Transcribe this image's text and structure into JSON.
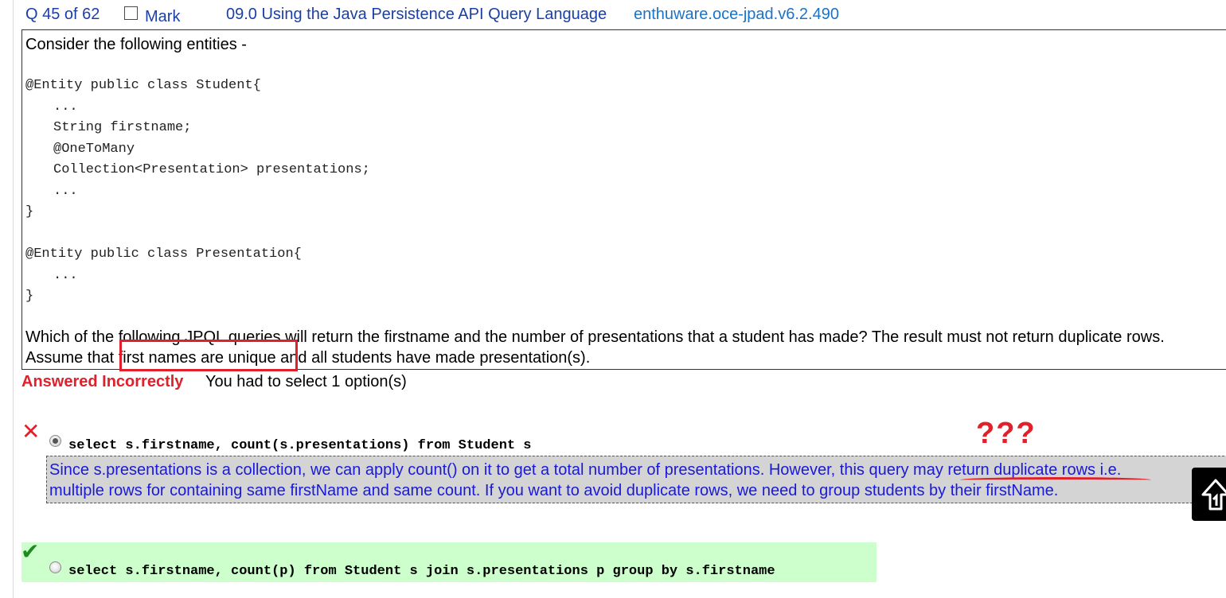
{
  "header": {
    "counter": "Q 45 of 62",
    "mark_label": "Mark",
    "topic": "09.0 Using the Java Persistence API Query Language",
    "question_id": "enthuware.oce-jpad.v6.2.490"
  },
  "question": {
    "intro": "Consider the following entities -",
    "code": [
      "@Entity public class Student{",
      "...",
      "String firstname;",
      "@OneToMany",
      "Collection<Presentation> presentations;",
      "...",
      "}",
      "@Entity public class Presentation{",
      "...",
      "}"
    ],
    "prompt_line1": "Which of the following JPQL queries will return the firstname and the number of presentations that a student has made? The result must not return duplicate rows.",
    "prompt_line2": "Assume that first names are unique and all students have made presentation(s)."
  },
  "result": {
    "status": "Answered Incorrectly",
    "note": "You had to select 1 option(s)"
  },
  "options": [
    {
      "text": "select s.firstname, count(s.presentations) from Student s",
      "selected": true,
      "correct": false,
      "explanation_line1": "Since s.presentations is a collection, we can apply count() on it to get a total number of presentations. However, this query may return duplicate rows i.e.",
      "explanation_line2": "multiple rows for containing same firstName and same count. If you want to avoid duplicate rows, we need to group students by their firstName."
    },
    {
      "text": "select s.firstname, count(p) from Student s join s.presentations p group by s.firstname",
      "selected": false,
      "correct": true
    }
  ],
  "annotation": {
    "question_marks": "???"
  },
  "icons": {
    "wrong": "x-icon",
    "right": "check-icon",
    "float": "home-arrow-icon"
  },
  "colors": {
    "link_blue": "#1a3fa6",
    "error_red": "#e0202a",
    "explanation_blue": "#1a1ad6",
    "correct_green_bg": "#ccffcc",
    "explanation_bg": "#d4d4d4"
  }
}
